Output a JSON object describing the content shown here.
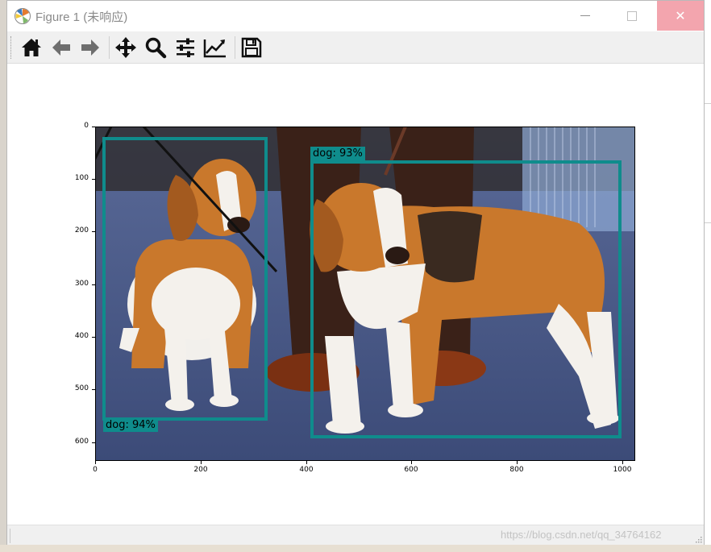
{
  "window": {
    "title": "Figure 1 (未响应)",
    "close_symbol": "✕"
  },
  "toolbar": {
    "buttons": [
      {
        "name": "home-icon",
        "tooltip": "Home"
      },
      {
        "name": "back-arrow-icon",
        "tooltip": "Back"
      },
      {
        "name": "forward-arrow-icon",
        "tooltip": "Forward"
      },
      {
        "name": "pan-icon",
        "tooltip": "Pan"
      },
      {
        "name": "zoom-icon",
        "tooltip": "Zoom"
      },
      {
        "name": "configure-subplots-icon",
        "tooltip": "Subplots"
      },
      {
        "name": "edit-axis-icon",
        "tooltip": "Customize"
      },
      {
        "name": "save-icon",
        "tooltip": "Save"
      }
    ]
  },
  "plot": {
    "y_ticks": [
      "0",
      "100",
      "200",
      "300",
      "400",
      "500",
      "600"
    ],
    "x_ticks": [
      "0",
      "200",
      "400",
      "600",
      "800",
      "1000"
    ],
    "detections": [
      {
        "label": "dog: 94%"
      },
      {
        "label": "dog: 93%"
      }
    ],
    "box_color": "#0f8c8c"
  },
  "watermark": "https://blog.csdn.net/qq_34764162"
}
